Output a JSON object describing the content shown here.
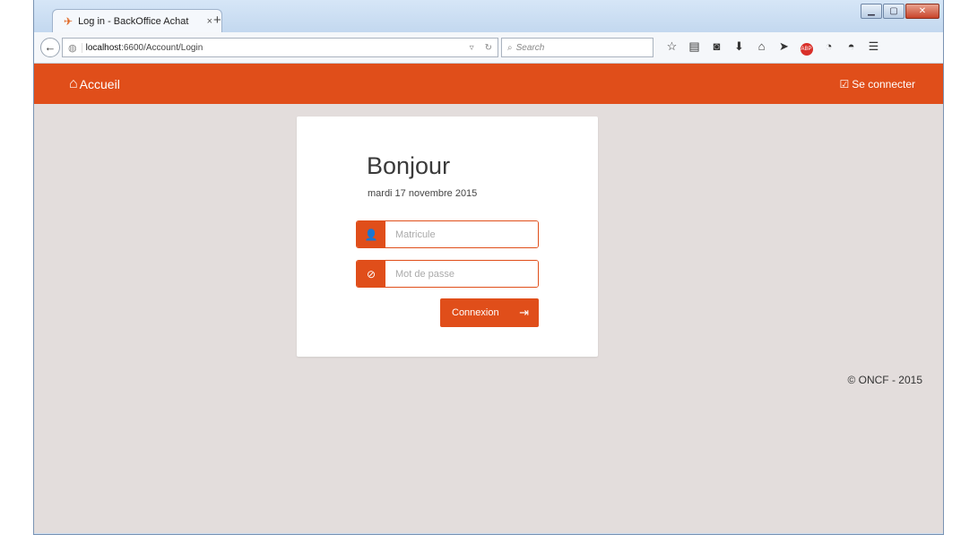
{
  "browser": {
    "tab_title": "Log in - BackOffice Achat",
    "tab_close": "×",
    "new_tab": "+",
    "url_host": "localhost",
    "url_path": ":6600/Account/Login",
    "search_placeholder": "Search",
    "toolbar_icons": [
      "star-icon",
      "reading-list-icon",
      "pocket-icon",
      "download-icon",
      "home-icon",
      "send-icon",
      "adblock-icon",
      "history-icon",
      "chat-icon",
      "menu-icon"
    ]
  },
  "header": {
    "brand_label": "Accueil",
    "login_label": "Se connecter"
  },
  "login": {
    "greeting": "Bonjour",
    "date": "mardi 17 novembre 2015",
    "username_placeholder": "Matricule",
    "password_placeholder": "Mot de passe",
    "submit_label": "Connexion"
  },
  "footer": {
    "copyright": "© ONCF - 2015"
  },
  "colors": {
    "accent": "#e04e1a",
    "background": "#e3dddc"
  }
}
